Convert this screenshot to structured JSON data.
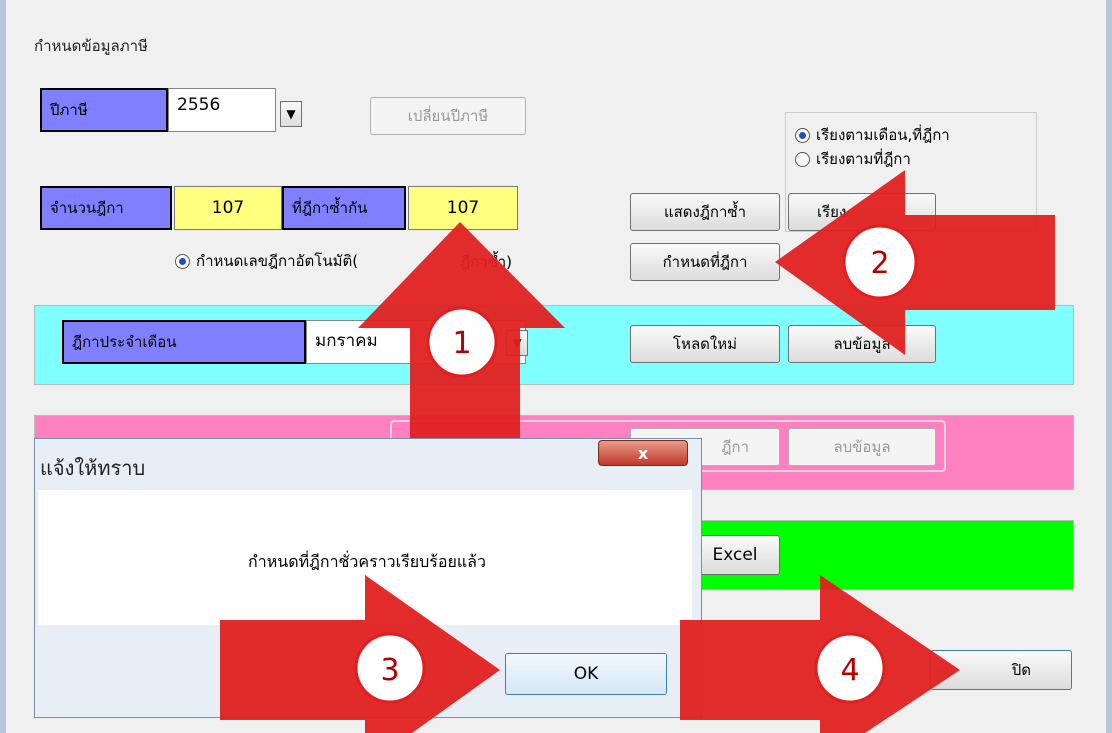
{
  "window": {
    "title": "กำหนดข้อมูลภาษี"
  },
  "year": {
    "label": "ปีภาษี",
    "value": "2556",
    "change_button": "เปลี่ยนปีภาษี"
  },
  "sort_options": [
    {
      "label": "เรียงตามเดือน,ที่ฎีกา",
      "selected": true
    },
    {
      "label": "เรียงตามที่ฎีกา",
      "selected": false
    }
  ],
  "counts": {
    "count_label": "จำนวนฎีกา",
    "count_value": "107",
    "dup_label": "ที่ฎีกาซ้ำกัน",
    "dup_value": "107"
  },
  "buttons": {
    "show_dup": "แสดงฎีกาซ้ำ",
    "sort": "เรียง",
    "set_number": "กำหนดที่ฎีกา",
    "reload": "โหลดใหม่",
    "delete_data": "ลบข้อมูล",
    "delete_data2": "ลบข้อมูล",
    "pink_btn": "ฎีกา",
    "excel": "Excel",
    "close": "ปิด"
  },
  "auto_option": {
    "label": "กำหนดเลขฎีกาอัตโนมัติ(",
    "label_tail": "ฎีกาซ้ำ)",
    "selected": true
  },
  "monthly": {
    "label": "ฎีกาประจำเดือน",
    "month": "มกราคม"
  },
  "dialog": {
    "title": "แจ้งให้ทราบ",
    "message": "กำหนดที่ฎีกาชั่วคราวเรียบร้อยแล้ว",
    "ok": "OK",
    "close": "x"
  },
  "callouts": [
    "1",
    "2",
    "3",
    "4"
  ],
  "colors": {
    "arrow": "#e02020",
    "label_blue": "#8080ff",
    "yellow": "#ffff80",
    "cyan": "#80ffff",
    "pink": "#ff80c0",
    "green": "#00ff00"
  }
}
